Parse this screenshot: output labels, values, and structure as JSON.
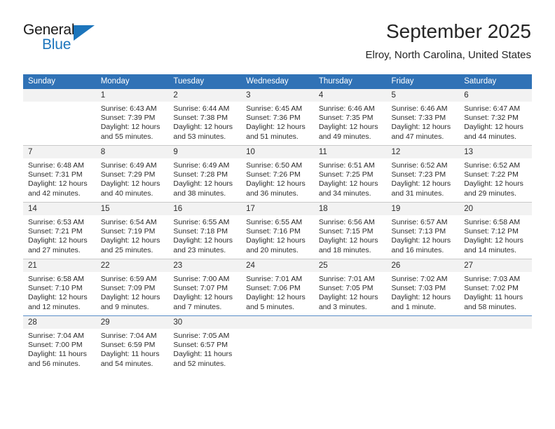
{
  "brand": {
    "name_part1": "General",
    "name_part2": "Blue",
    "accent_color": "#1c75bc",
    "triangle_icon": "triangle-icon"
  },
  "header": {
    "month_title": "September 2025",
    "location": "Elroy, North Carolina, United States"
  },
  "calendar": {
    "header_bg": "#3072b6",
    "daynum_bg": "#f2f2f2",
    "weekday_headers": [
      "Sunday",
      "Monday",
      "Tuesday",
      "Wednesday",
      "Thursday",
      "Friday",
      "Saturday"
    ],
    "weeks": [
      [
        {
          "day": "",
          "sunrise": "",
          "sunset": "",
          "daylight_line1": "",
          "daylight_line2": ""
        },
        {
          "day": "1",
          "sunrise": "Sunrise: 6:43 AM",
          "sunset": "Sunset: 7:39 PM",
          "daylight_line1": "Daylight: 12 hours",
          "daylight_line2": "and 55 minutes."
        },
        {
          "day": "2",
          "sunrise": "Sunrise: 6:44 AM",
          "sunset": "Sunset: 7:38 PM",
          "daylight_line1": "Daylight: 12 hours",
          "daylight_line2": "and 53 minutes."
        },
        {
          "day": "3",
          "sunrise": "Sunrise: 6:45 AM",
          "sunset": "Sunset: 7:36 PM",
          "daylight_line1": "Daylight: 12 hours",
          "daylight_line2": "and 51 minutes."
        },
        {
          "day": "4",
          "sunrise": "Sunrise: 6:46 AM",
          "sunset": "Sunset: 7:35 PM",
          "daylight_line1": "Daylight: 12 hours",
          "daylight_line2": "and 49 minutes."
        },
        {
          "day": "5",
          "sunrise": "Sunrise: 6:46 AM",
          "sunset": "Sunset: 7:33 PM",
          "daylight_line1": "Daylight: 12 hours",
          "daylight_line2": "and 47 minutes."
        },
        {
          "day": "6",
          "sunrise": "Sunrise: 6:47 AM",
          "sunset": "Sunset: 7:32 PM",
          "daylight_line1": "Daylight: 12 hours",
          "daylight_line2": "and 44 minutes."
        }
      ],
      [
        {
          "day": "7",
          "sunrise": "Sunrise: 6:48 AM",
          "sunset": "Sunset: 7:31 PM",
          "daylight_line1": "Daylight: 12 hours",
          "daylight_line2": "and 42 minutes."
        },
        {
          "day": "8",
          "sunrise": "Sunrise: 6:49 AM",
          "sunset": "Sunset: 7:29 PM",
          "daylight_line1": "Daylight: 12 hours",
          "daylight_line2": "and 40 minutes."
        },
        {
          "day": "9",
          "sunrise": "Sunrise: 6:49 AM",
          "sunset": "Sunset: 7:28 PM",
          "daylight_line1": "Daylight: 12 hours",
          "daylight_line2": "and 38 minutes."
        },
        {
          "day": "10",
          "sunrise": "Sunrise: 6:50 AM",
          "sunset": "Sunset: 7:26 PM",
          "daylight_line1": "Daylight: 12 hours",
          "daylight_line2": "and 36 minutes."
        },
        {
          "day": "11",
          "sunrise": "Sunrise: 6:51 AM",
          "sunset": "Sunset: 7:25 PM",
          "daylight_line1": "Daylight: 12 hours",
          "daylight_line2": "and 34 minutes."
        },
        {
          "day": "12",
          "sunrise": "Sunrise: 6:52 AM",
          "sunset": "Sunset: 7:23 PM",
          "daylight_line1": "Daylight: 12 hours",
          "daylight_line2": "and 31 minutes."
        },
        {
          "day": "13",
          "sunrise": "Sunrise: 6:52 AM",
          "sunset": "Sunset: 7:22 PM",
          "daylight_line1": "Daylight: 12 hours",
          "daylight_line2": "and 29 minutes."
        }
      ],
      [
        {
          "day": "14",
          "sunrise": "Sunrise: 6:53 AM",
          "sunset": "Sunset: 7:21 PM",
          "daylight_line1": "Daylight: 12 hours",
          "daylight_line2": "and 27 minutes."
        },
        {
          "day": "15",
          "sunrise": "Sunrise: 6:54 AM",
          "sunset": "Sunset: 7:19 PM",
          "daylight_line1": "Daylight: 12 hours",
          "daylight_line2": "and 25 minutes."
        },
        {
          "day": "16",
          "sunrise": "Sunrise: 6:55 AM",
          "sunset": "Sunset: 7:18 PM",
          "daylight_line1": "Daylight: 12 hours",
          "daylight_line2": "and 23 minutes."
        },
        {
          "day": "17",
          "sunrise": "Sunrise: 6:55 AM",
          "sunset": "Sunset: 7:16 PM",
          "daylight_line1": "Daylight: 12 hours",
          "daylight_line2": "and 20 minutes."
        },
        {
          "day": "18",
          "sunrise": "Sunrise: 6:56 AM",
          "sunset": "Sunset: 7:15 PM",
          "daylight_line1": "Daylight: 12 hours",
          "daylight_line2": "and 18 minutes."
        },
        {
          "day": "19",
          "sunrise": "Sunrise: 6:57 AM",
          "sunset": "Sunset: 7:13 PM",
          "daylight_line1": "Daylight: 12 hours",
          "daylight_line2": "and 16 minutes."
        },
        {
          "day": "20",
          "sunrise": "Sunrise: 6:58 AM",
          "sunset": "Sunset: 7:12 PM",
          "daylight_line1": "Daylight: 12 hours",
          "daylight_line2": "and 14 minutes."
        }
      ],
      [
        {
          "day": "21",
          "sunrise": "Sunrise: 6:58 AM",
          "sunset": "Sunset: 7:10 PM",
          "daylight_line1": "Daylight: 12 hours",
          "daylight_line2": "and 12 minutes."
        },
        {
          "day": "22",
          "sunrise": "Sunrise: 6:59 AM",
          "sunset": "Sunset: 7:09 PM",
          "daylight_line1": "Daylight: 12 hours",
          "daylight_line2": "and 9 minutes."
        },
        {
          "day": "23",
          "sunrise": "Sunrise: 7:00 AM",
          "sunset": "Sunset: 7:07 PM",
          "daylight_line1": "Daylight: 12 hours",
          "daylight_line2": "and 7 minutes."
        },
        {
          "day": "24",
          "sunrise": "Sunrise: 7:01 AM",
          "sunset": "Sunset: 7:06 PM",
          "daylight_line1": "Daylight: 12 hours",
          "daylight_line2": "and 5 minutes."
        },
        {
          "day": "25",
          "sunrise": "Sunrise: 7:01 AM",
          "sunset": "Sunset: 7:05 PM",
          "daylight_line1": "Daylight: 12 hours",
          "daylight_line2": "and 3 minutes."
        },
        {
          "day": "26",
          "sunrise": "Sunrise: 7:02 AM",
          "sunset": "Sunset: 7:03 PM",
          "daylight_line1": "Daylight: 12 hours",
          "daylight_line2": "and 1 minute."
        },
        {
          "day": "27",
          "sunrise": "Sunrise: 7:03 AM",
          "sunset": "Sunset: 7:02 PM",
          "daylight_line1": "Daylight: 11 hours",
          "daylight_line2": "and 58 minutes."
        }
      ],
      [
        {
          "day": "28",
          "sunrise": "Sunrise: 7:04 AM",
          "sunset": "Sunset: 7:00 PM",
          "daylight_line1": "Daylight: 11 hours",
          "daylight_line2": "and 56 minutes."
        },
        {
          "day": "29",
          "sunrise": "Sunrise: 7:04 AM",
          "sunset": "Sunset: 6:59 PM",
          "daylight_line1": "Daylight: 11 hours",
          "daylight_line2": "and 54 minutes."
        },
        {
          "day": "30",
          "sunrise": "Sunrise: 7:05 AM",
          "sunset": "Sunset: 6:57 PM",
          "daylight_line1": "Daylight: 11 hours",
          "daylight_line2": "and 52 minutes."
        },
        {
          "day": "",
          "sunrise": "",
          "sunset": "",
          "daylight_line1": "",
          "daylight_line2": ""
        },
        {
          "day": "",
          "sunrise": "",
          "sunset": "",
          "daylight_line1": "",
          "daylight_line2": ""
        },
        {
          "day": "",
          "sunrise": "",
          "sunset": "",
          "daylight_line1": "",
          "daylight_line2": ""
        },
        {
          "day": "",
          "sunrise": "",
          "sunset": "",
          "daylight_line1": "",
          "daylight_line2": ""
        }
      ]
    ]
  }
}
